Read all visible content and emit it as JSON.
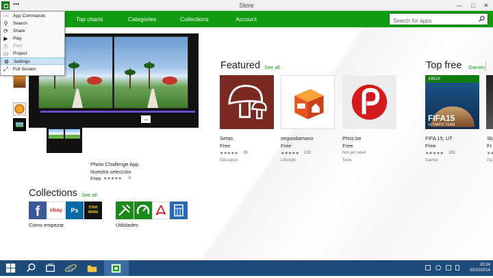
{
  "window": {
    "title": "Store",
    "menu_dots": "•••",
    "minimize": "—",
    "maximize": "□",
    "close": "✕"
  },
  "nav": {
    "items": [
      "Top charts",
      "Categories",
      "Collections",
      "Account"
    ],
    "search_placeholder": "Search for apps"
  },
  "menu": {
    "items": [
      {
        "label": "App Commands",
        "icon": "dots-icon",
        "disabled": false
      },
      {
        "label": "Search",
        "icon": "search-icon",
        "disabled": false
      },
      {
        "label": "Share",
        "icon": "share-icon",
        "disabled": false
      },
      {
        "label": "Play",
        "icon": "play-icon",
        "disabled": false
      },
      {
        "label": "Print",
        "icon": "print-icon",
        "disabled": true
      },
      {
        "label": "Project",
        "icon": "project-icon",
        "disabled": false
      },
      {
        "label": "Settings",
        "icon": "gear-icon",
        "disabled": false,
        "active": true
      },
      {
        "label": "Full Screen",
        "icon": "fullscreen-icon",
        "disabled": false
      }
    ]
  },
  "hero": {
    "app_name": "Photo Challenge App",
    "subtitle": "Nuestra selección",
    "price": "Free",
    "stars": "★★★★★",
    "rating_count": "6",
    "arrow": "→"
  },
  "featured": {
    "title": "Featured",
    "see_all": "See all",
    "apps": [
      {
        "name": "Setas",
        "price": "Free",
        "stars": "★★★★★",
        "count": "39",
        "category": "Education"
      },
      {
        "name": "segundamano",
        "price": "Free",
        "stars": "★★★★★",
        "count": "133",
        "category": "Lifestyle"
      },
      {
        "name": "Phriz.be",
        "price": "Free",
        "rating": "Not yet rated",
        "category": "Tools"
      }
    ]
  },
  "top_free": {
    "title": "Top free",
    "filter": "Games",
    "apps": [
      {
        "name": "FIFA 15: UT",
        "price": "Free",
        "stars": "★★★★★",
        "count": "281",
        "category": "Games",
        "badge": "XBOX",
        "tile_title": "FIFA15",
        "tile_sub": "ULTIMATE TEAM"
      },
      {
        "name": "Sk",
        "price": "Fr",
        "stars": "★★",
        "category": "Ga"
      }
    ]
  },
  "collections": {
    "title": "Collections",
    "see_all": "See all",
    "groups": [
      {
        "label": "Cómo empezar"
      },
      {
        "label": "Utilidades"
      }
    ],
    "icon_text": [
      "f",
      "ebay",
      "Ps",
      "STAR WARS"
    ]
  },
  "taskbar": {
    "time": "20:24",
    "date": "03/10/2014"
  },
  "colors": {
    "accent": "#119b11",
    "taskbar": "#1f4b7a",
    "setas": "#7a2a22",
    "segunda": "#e8531f",
    "phriz": "#d11b1f"
  }
}
